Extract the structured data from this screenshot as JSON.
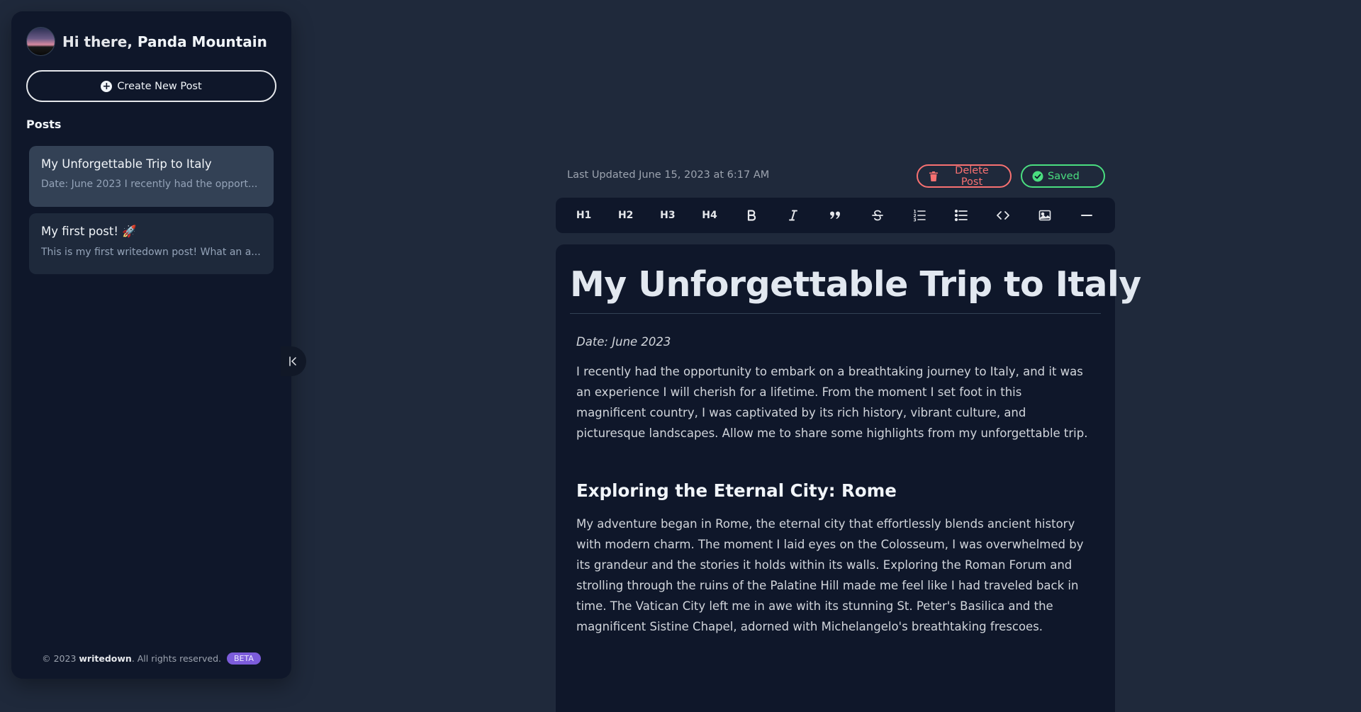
{
  "sidebar": {
    "greeting_prefix": "Hi there, ",
    "user_name": "Panda Mountain",
    "create_label": "Create New Post",
    "posts_heading": "Posts",
    "posts": [
      {
        "title": "My Unforgettable Trip to Italy",
        "excerpt": "Date: June 2023 I recently had the opport...",
        "active": true
      },
      {
        "title": "My first post! 🚀",
        "excerpt": "This is my first writedown post! What an a...",
        "active": false
      }
    ],
    "footer": {
      "copyright": "© 2023 ",
      "brand": "writedown",
      "rights": ". All rights reserved.",
      "badge": "BETA"
    }
  },
  "editor_header": {
    "last_updated": "Last Updated June 15, 2023 at 6:17 AM",
    "delete_label": "Delete Post",
    "saved_label": "Saved"
  },
  "toolbar": {
    "tools": [
      {
        "name": "heading-1",
        "label": "H1"
      },
      {
        "name": "heading-2",
        "label": "H2"
      },
      {
        "name": "heading-3",
        "label": "H3"
      },
      {
        "name": "heading-4",
        "label": "H4"
      },
      {
        "name": "bold-icon"
      },
      {
        "name": "italic-icon"
      },
      {
        "name": "quote-icon"
      },
      {
        "name": "strikethrough-icon"
      },
      {
        "name": "ordered-list-icon"
      },
      {
        "name": "bullet-list-icon"
      },
      {
        "name": "code-icon"
      },
      {
        "name": "image-icon"
      },
      {
        "name": "horizontal-rule-icon"
      }
    ]
  },
  "document": {
    "title": "My Unforgettable Trip to Italy",
    "date": "Date: June 2023",
    "intro": "I recently had the opportunity to embark on a breathtaking journey to Italy, and it was an experience I will cherish for a lifetime. From the moment I set foot in this magnificent country, I was captivated by its rich history, vibrant culture, and picturesque landscapes. Allow me to share some highlights from my unforgettable trip.",
    "section1_heading": "Exploring the Eternal City: Rome",
    "section1_body": "My adventure began in Rome, the eternal city that effortlessly blends ancient history with modern charm. The moment I laid eyes on the Colosseum, I was overwhelmed by its grandeur and the stories it holds within its walls. Exploring the Roman Forum and strolling through the ruins of the Palatine Hill made me feel like I had traveled back in time. The Vatican City left me in awe with its stunning St. Peter's Basilica and the magnificent Sistine Chapel, adorned with Michelangelo's breathtaking frescoes."
  },
  "colors": {
    "background": "#1f293b",
    "panel": "#0f172a",
    "active_card": "#334155",
    "danger": "#f87171",
    "success": "#4ade80",
    "beta_badge": "#7c5cdb"
  }
}
